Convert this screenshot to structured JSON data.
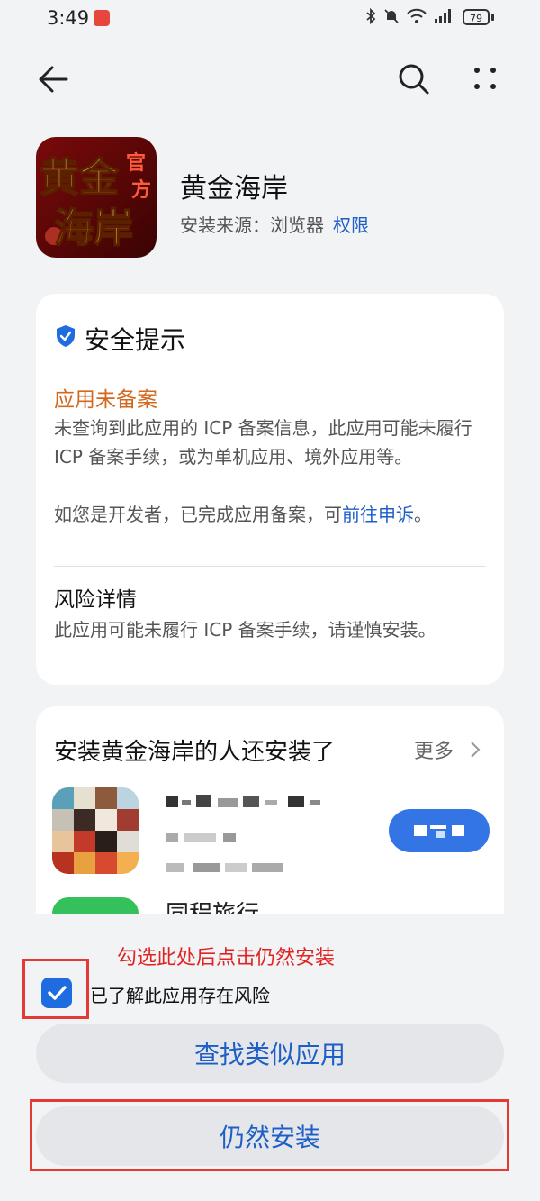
{
  "status_bar": {
    "time": "3:49",
    "battery": "79"
  },
  "app": {
    "name": "黄金海岸",
    "source_label": "安装来源：浏览器",
    "permissions_link": "权限",
    "icon_text": "黄金海岸",
    "icon_badge": "官方"
  },
  "safety": {
    "title": "安全提示",
    "warning_title": "应用未备案",
    "warning_text": "未查询到此应用的 ICP 备案信息，此应用可能未履行 ICP 备案手续，或为单机应用、境外应用等。",
    "developer_prefix": "如您是开发者，已完成应用备案，可",
    "appeal_link": "前往申诉",
    "developer_suffix": "。",
    "risk_title": "风险详情",
    "risk_text": "此应用可能未履行 ICP 备案手续，请谨慎安装。"
  },
  "related": {
    "title": "安装黄金海岸的人还安装了",
    "more_label": "更多",
    "second_app_name": "同程旅行"
  },
  "bottom": {
    "hint": "勾选此处后点击仍然安装",
    "checkbox_label": "已了解此应用存在风险",
    "checkbox_checked": true,
    "find_similar": "查找类似应用",
    "install_anyway": "仍然安装"
  },
  "colors": {
    "accent": "#1e5fc7",
    "warning": "#d2691e",
    "annotation": "#e53935"
  }
}
